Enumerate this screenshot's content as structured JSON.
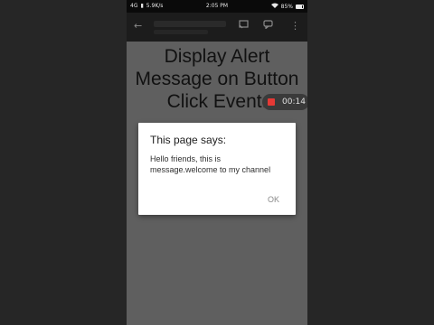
{
  "status_bar": {
    "network": "4G",
    "signal": "▮",
    "speed": "5.9K/s",
    "time": "2:05 PM",
    "wifi_icon": "wifi-icon",
    "battery_percent": "85%"
  },
  "toolbar": {
    "back_icon": "back-arrow-icon",
    "cast_icon": "cast-icon",
    "chat_icon": "chat-icon",
    "menu_icon": "more-vert-icon"
  },
  "page": {
    "heading": "Display Alert Message on Button Click Event."
  },
  "recording": {
    "time": "00:14",
    "indicator_color": "#e53935"
  },
  "dialog": {
    "title": "This page says:",
    "message": "Hello friends, this is message.welcome to my channel",
    "ok_label": "OK"
  }
}
